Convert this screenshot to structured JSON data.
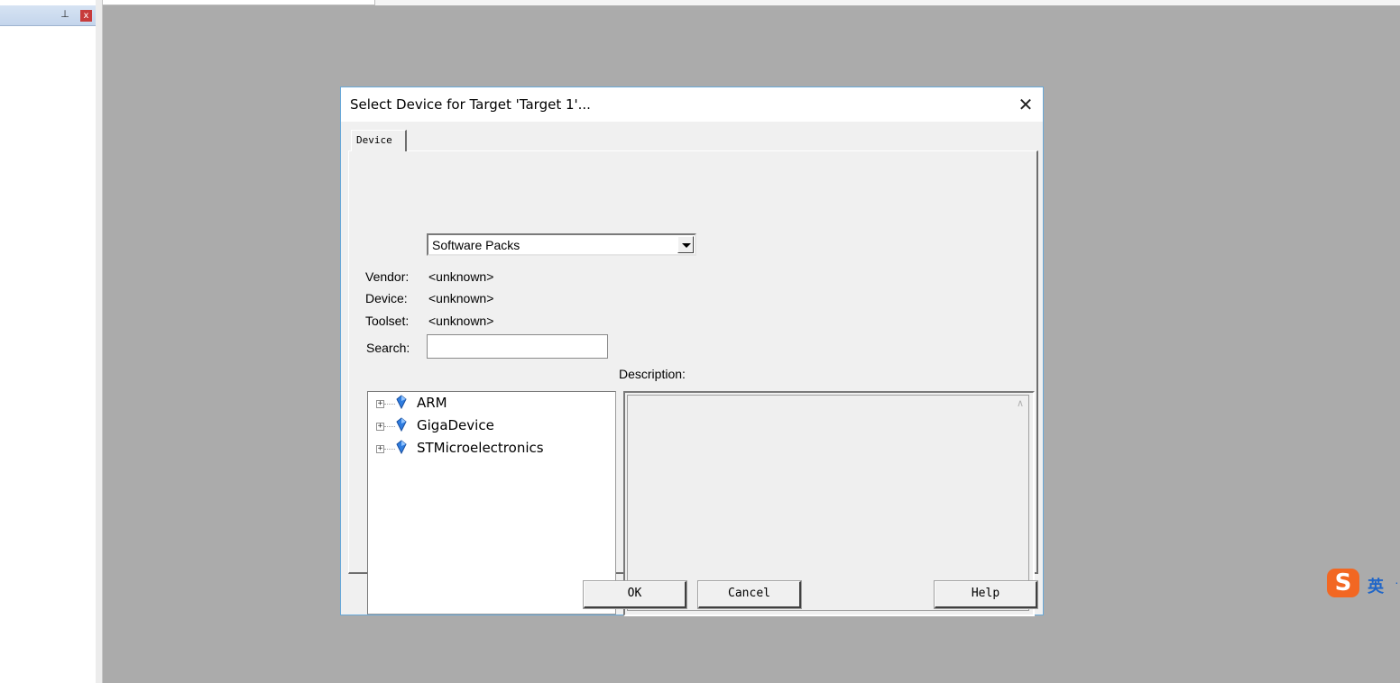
{
  "left_panel": {
    "pin_icon": "pin-icon",
    "close_icon": "close-icon"
  },
  "dialog": {
    "title": "Select Device for Target 'Target 1'...",
    "close_glyph": "✕",
    "tab_label": "Device",
    "source_select": {
      "value": "Software Packs"
    },
    "fields": {
      "vendor_label": "Vendor:",
      "vendor_value": "<unknown>",
      "device_label": "Device:",
      "device_value": "<unknown>",
      "toolset_label": "Toolset:",
      "toolset_value": "<unknown>",
      "search_label": "Search:",
      "search_value": ""
    },
    "tree_items": [
      {
        "label": "ARM"
      },
      {
        "label": "GigaDevice"
      },
      {
        "label": "STMicroelectronics"
      }
    ],
    "description_label": "Description:",
    "description_text": "",
    "buttons": {
      "ok": "OK",
      "cancel": "Cancel",
      "help": "Help"
    }
  },
  "ime": {
    "logo": "S",
    "mode": "英",
    "extra": "·"
  },
  "colors": {
    "workspace": "#ababab",
    "dialog_border": "#68a8d8",
    "ime_orange": "#f26722",
    "ime_blue": "#2066c8"
  }
}
